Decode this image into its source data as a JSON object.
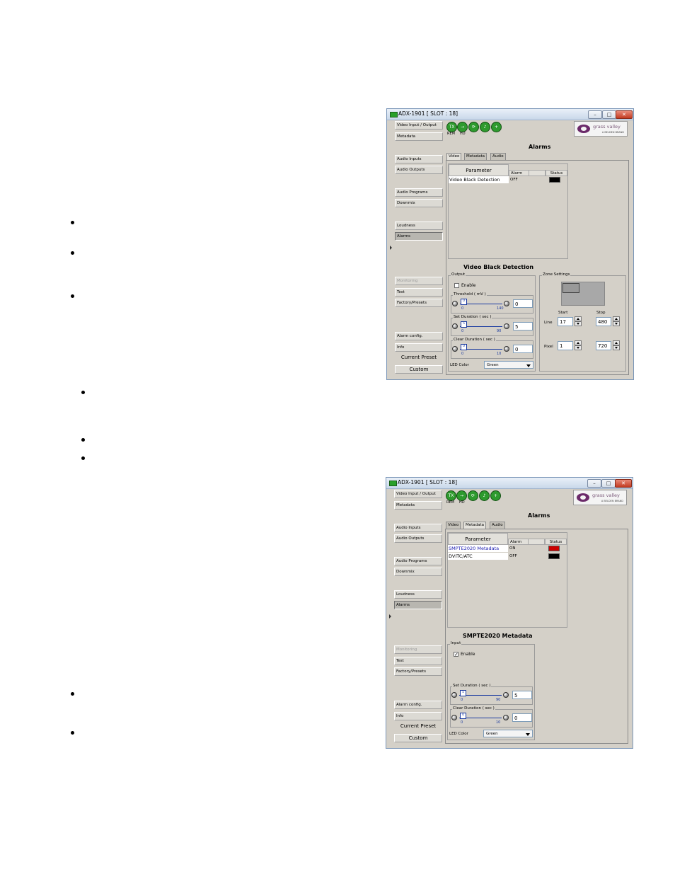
{
  "windows": [
    {
      "title": "ADX-1901 [ SLOT : 18]",
      "sidebar": [
        {
          "label": "Video Input / Output",
          "state": "normal"
        },
        {
          "label": "Metadata",
          "state": "normal"
        },
        {
          "label": "Audio Inputs",
          "state": "normal"
        },
        {
          "label": "Audio Outputs",
          "state": "normal"
        },
        {
          "label": "Audio Programs",
          "state": "normal"
        },
        {
          "label": "Downmix",
          "state": "normal"
        },
        {
          "label": "Loudness",
          "state": "normal"
        },
        {
          "label": "Alarms",
          "state": "active"
        },
        {
          "label": "Monitoring",
          "state": "disabled"
        },
        {
          "label": "Test",
          "state": "normal"
        },
        {
          "label": "Factory/Presets",
          "state": "normal"
        },
        {
          "label": "Alarm config.",
          "state": "normal"
        },
        {
          "label": "Info",
          "state": "normal"
        },
        {
          "label": "Current Preset",
          "state": "normal"
        },
        {
          "label": "Custom",
          "state": "normal"
        }
      ],
      "status_icons": [
        {
          "icon": "tx-icon",
          "text": "TX"
        },
        {
          "icon": "arrow-right-icon",
          "text": "→"
        },
        {
          "icon": "refresh-icon",
          "text": "⟳"
        },
        {
          "icon": "audio-icon",
          "text": "♪"
        },
        {
          "icon": "plus-icon",
          "text": "+"
        }
      ],
      "status_labels": [
        "REM",
        "HD"
      ],
      "logo": {
        "name": "grass valley",
        "sub": "A BELDEN BRAND"
      },
      "header": "Alarms",
      "tabs": [
        {
          "label": "Video",
          "active": true
        },
        {
          "label": "Metadata",
          "active": false
        },
        {
          "label": "Audio",
          "active": false
        }
      ],
      "table": {
        "parameter_header": "Parameter",
        "alarm_header": "Alarm",
        "status_header": "Status",
        "rows": [
          {
            "name": "Video Black Detection",
            "value": "OFF",
            "status_color": "#000000",
            "selected": false
          }
        ]
      },
      "section_title": "Video Black Detection",
      "group_label": "Output",
      "enable": {
        "label": "Enable",
        "checked": false
      },
      "sliders": [
        {
          "label": "Threshold ( mV )",
          "min": "0",
          "max": "140",
          "value": "0",
          "thumb": "0"
        },
        {
          "label": "Set Duration ( sec )",
          "min": "0",
          "max": "90",
          "value": "5",
          "thumb": "5"
        },
        {
          "label": "Clear Duration ( sec )",
          "min": "0",
          "max": "10",
          "value": "0",
          "thumb": "0"
        }
      ],
      "led": {
        "label": "LED Color",
        "value": "Green"
      },
      "zone": {
        "label": "Zone Settings",
        "start_label": "Start",
        "stop_label": "Stop",
        "line_label": "Line",
        "pixel_label": "Pixel",
        "line_start": "17",
        "line_stop": "480",
        "pixel_start": "1",
        "pixel_stop": "720"
      }
    },
    {
      "title": "ADX-1901 [ SLOT : 18]",
      "sidebar": [
        {
          "label": "Video Input / Output",
          "state": "normal"
        },
        {
          "label": "Metadata",
          "state": "normal"
        },
        {
          "label": "Audio Inputs",
          "state": "normal"
        },
        {
          "label": "Audio Outputs",
          "state": "normal"
        },
        {
          "label": "Audio Programs",
          "state": "normal"
        },
        {
          "label": "Downmix",
          "state": "normal"
        },
        {
          "label": "Loudness",
          "state": "normal"
        },
        {
          "label": "Alarms",
          "state": "active"
        },
        {
          "label": "Monitoring",
          "state": "disabled"
        },
        {
          "label": "Test",
          "state": "normal"
        },
        {
          "label": "Factory/Presets",
          "state": "normal"
        },
        {
          "label": "Alarm config.",
          "state": "normal"
        },
        {
          "label": "Info",
          "state": "normal"
        },
        {
          "label": "Current Preset",
          "state": "normal"
        },
        {
          "label": "Custom",
          "state": "normal"
        }
      ],
      "status_icons": [
        {
          "icon": "tx-icon",
          "text": "TX"
        },
        {
          "icon": "arrow-right-icon",
          "text": "→"
        },
        {
          "icon": "refresh-icon",
          "text": "⟳"
        },
        {
          "icon": "audio-icon",
          "text": "♪"
        },
        {
          "icon": "plus-icon",
          "text": "+"
        }
      ],
      "status_labels": [
        "REM",
        "HD"
      ],
      "logo": {
        "name": "grass valley",
        "sub": "A BELDEN BRAND"
      },
      "header": "Alarms",
      "tabs": [
        {
          "label": "Video",
          "active": false
        },
        {
          "label": "Metadata",
          "active": true
        },
        {
          "label": "Audio",
          "active": false
        }
      ],
      "table": {
        "parameter_header": "Parameter",
        "alarm_header": "Alarm",
        "status_header": "Status",
        "rows": [
          {
            "name": "SMPTE2020 Metadata",
            "value": "ON",
            "status_color": "#cc0000",
            "selected": true
          },
          {
            "name": "DVITC/ATC",
            "value": "OFF",
            "status_color": "#000000",
            "selected": false
          }
        ]
      },
      "section_title": "SMPTE2020 Metadata",
      "group_label": "Input",
      "enable": {
        "label": "Enable",
        "checked": true
      },
      "sliders": [
        {
          "label": "Set Duration ( sec )",
          "min": "0",
          "max": "90",
          "value": "5",
          "thumb": "5"
        },
        {
          "label": "Clear Duration ( sec )",
          "min": "0",
          "max": "10",
          "value": "0",
          "thumb": "0"
        }
      ],
      "led": {
        "label": "LED Color",
        "value": "Green"
      }
    }
  ]
}
